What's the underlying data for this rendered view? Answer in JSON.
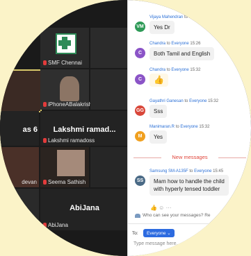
{
  "grid": {
    "tiles": [
      {
        "name": "SMF Chennai"
      },
      {
        "name": "iPhoneABalakrishnan"
      },
      {
        "big_name": "as 6"
      },
      {
        "big_name": "Lakshmi ramad...",
        "name": "Lakshmi ramadoss"
      },
      {
        "name": "devan"
      },
      {
        "name": "Seema Sathish"
      },
      {
        "big_name": "AbiJana",
        "name": "AbiJana"
      }
    ]
  },
  "chat": {
    "messages": [
      {
        "sender": "Vijaya Mahendran",
        "to": "to E...",
        "time": "",
        "initials": "VM",
        "color": "#2e9a57",
        "text": "Yes Dr"
      },
      {
        "sender": "Chandra",
        "to": "to",
        "audience": "Everyone",
        "time": "15:26",
        "initials": "C",
        "color": "#8b54c7",
        "text": "Both Tamil and English"
      },
      {
        "sender": "Chandra",
        "to": "to",
        "audience": "Everyone",
        "time": "15:32",
        "initials": "C",
        "color": "#8b54c7",
        "text": "👍"
      },
      {
        "sender": "Gayathri Ganesan",
        "to": "to",
        "audience": "Everyone",
        "time": "15:32",
        "initials": "GG",
        "color": "#d9473a",
        "text": "Sss"
      },
      {
        "sender": "Manimaran.R",
        "to": "to",
        "audience": "Everyone",
        "time": "15:32",
        "initials": "M",
        "color": "#f0a020",
        "text": "Yes"
      },
      {
        "sender": "Samsung SM-A135F",
        "to": "to",
        "audience": "Everyone",
        "time": "15:45",
        "initials": "SS",
        "color": "#4a6a86",
        "text_line1": "Mam how to handle the child",
        "text_line2": "with hyperly tensed toddler"
      }
    ],
    "new_messages_label": "New messages",
    "reactions": "👍 ☺ ···",
    "who_can_see": "Who can see your messages? Re",
    "to_label": "To:",
    "recipient": "Everyone ⌄",
    "input_placeholder": "Type message here..."
  }
}
